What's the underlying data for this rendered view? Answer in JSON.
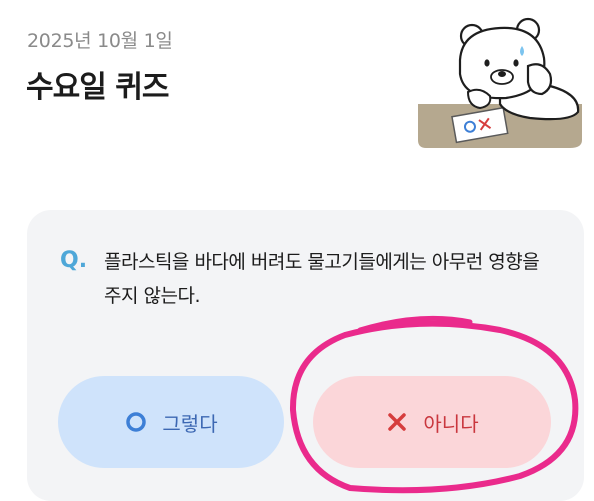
{
  "header": {
    "date": "2025년 10월 1일",
    "title": "수요일 퀴즈"
  },
  "mascot": {
    "icon": "bear-mascot-icon",
    "paper_text": "OX"
  },
  "quiz": {
    "q_label": "Q.",
    "question": "플라스틱을 바다에 버려도 물고기들에게는 아무런 영향을 주지 않는다.",
    "yes_label": "그렇다",
    "no_label": "아니다",
    "yes_icon": "circle-icon",
    "no_icon": "x-icon"
  },
  "colors": {
    "accent_blue": "#4ea7d8",
    "yes_bg": "#cfe3fb",
    "no_bg": "#fbd6d9",
    "annotation": "#ea2a8c"
  }
}
